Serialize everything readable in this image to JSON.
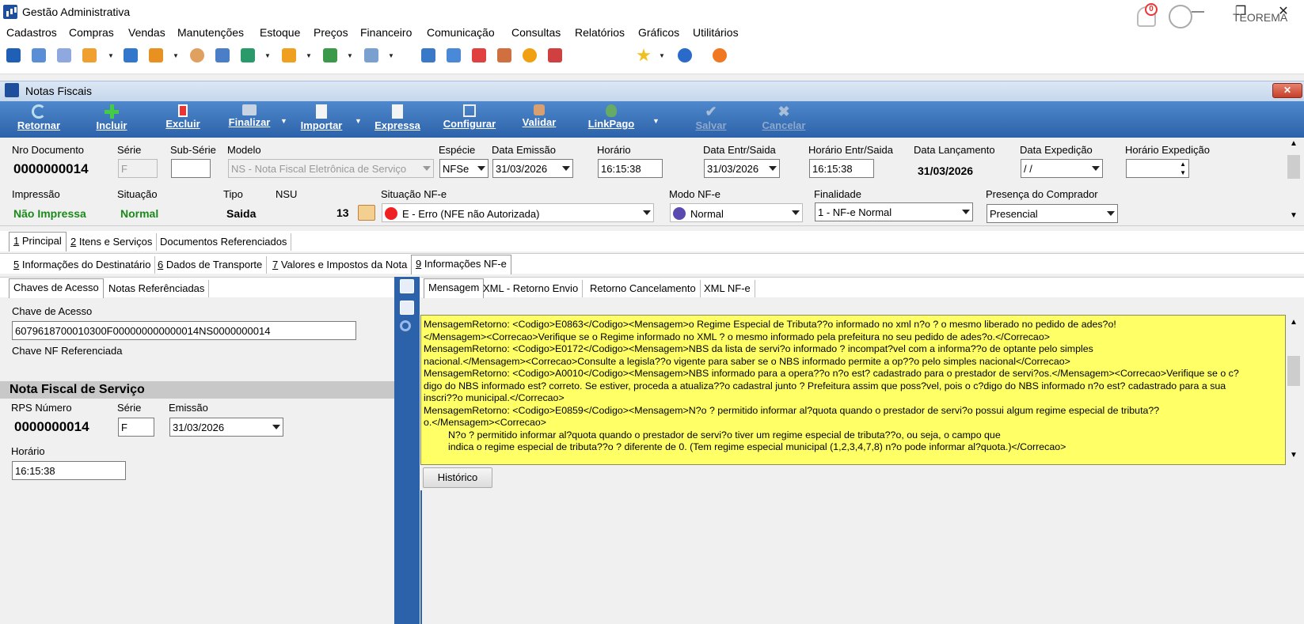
{
  "app": {
    "title": "Gestão Administrativa",
    "company": "TEOREMA",
    "notifications": "0"
  },
  "window_controls": {
    "minimize": "—",
    "restore": "❐",
    "close": "✕"
  },
  "menu": [
    "Cadastros",
    "Compras",
    "Vendas",
    "Manutenções",
    "Estoque",
    "Preços",
    "Financeiro",
    "Comunicação",
    "Consultas",
    "Relatórios",
    "Gráficos",
    "Utilitários"
  ],
  "window": {
    "title": "Notas Fiscais",
    "close": "✕"
  },
  "actions": {
    "retornar": "Retornar",
    "incluir": "Incluir",
    "excluir": "Excluir",
    "finalizar": "Finalizar",
    "importar": "Importar",
    "expressa": "Expressa",
    "configurar": "Configurar",
    "validar": "Validar",
    "linkpago": "LinkPago",
    "salvar": "Salvar",
    "cancelar": "Cancelar"
  },
  "form": {
    "nro_documento": {
      "label": "Nro Documento",
      "value": "0000000014"
    },
    "serie": {
      "label": "Série",
      "value": "F"
    },
    "sub_serie": {
      "label": "Sub-Série",
      "value": ""
    },
    "modelo": {
      "label": "Modelo",
      "value": "NS - Nota Fiscal Eletrônica de Serviço"
    },
    "especie": {
      "label": "Espécie",
      "value": "NFSe"
    },
    "data_emissao": {
      "label": "Data Emissão",
      "value": "31/03/2026"
    },
    "horario": {
      "label": "Horário",
      "value": "16:15:38"
    },
    "data_entr_saida": {
      "label": "Data Entr/Saida",
      "value": "31/03/2026"
    },
    "horario_entr_saida": {
      "label": "Horário Entr/Saida",
      "value": "16:15:38"
    },
    "data_lancamento": {
      "label": "Data Lançamento",
      "value": "31/03/2026"
    },
    "data_expedicao": {
      "label": "Data Expedição",
      "value": " / /"
    },
    "horario_expedicao": {
      "label": "Horário Expedição",
      "value": ""
    },
    "impressao": {
      "label": "Impressão",
      "value": "Não Impressa"
    },
    "situacao": {
      "label": "Situação",
      "value": "Normal"
    },
    "tipo": {
      "label": "Tipo",
      "value": "Saida"
    },
    "nsu": {
      "label": "NSU",
      "value": "13"
    },
    "situacao_nfe": {
      "label": "Situação NF-e",
      "value": "E - Erro (NFE não Autorizada)"
    },
    "modo_nfe": {
      "label": "Modo NF-e",
      "value": "Normal"
    },
    "finalidade": {
      "label": "Finalidade",
      "value": "1 - NF-e Normal"
    },
    "presenca": {
      "label": "Presença do Comprador",
      "value": "Presencial"
    }
  },
  "tabs_main": [
    {
      "key": "1",
      "label": " Principal"
    },
    {
      "key": "2",
      "label": " Itens e Serviços"
    },
    {
      "key": "",
      "label": "Documentos Referenciados"
    }
  ],
  "tabs_sub": [
    {
      "key": "5",
      "label": " Informações do Destinatário"
    },
    {
      "key": "6",
      "label": " Dados de Transporte"
    },
    {
      "key": "7",
      "label": " Valores e Impostos da Nota"
    },
    {
      "key": "9",
      "label": " Informações NF-e"
    }
  ],
  "tabs_left": [
    "Chaves de Acesso",
    "Notas Referênciadas"
  ],
  "tabs_right": [
    "Mensagem",
    "XML - Retorno Envio",
    "Retorno Cancelamento",
    "XML NF-e"
  ],
  "left": {
    "chave_acesso_label": "Chave de Acesso",
    "chave_acesso_value": "6079618700010300F000000000000014NS0000000014",
    "chave_nf_ref_label": "Chave NF Referenciada",
    "section_title": "Nota Fiscal de Serviço",
    "rps_label": "RPS Número",
    "rps_value": "0000000014",
    "serie_label": "Série",
    "serie_value": "F",
    "emissao_label": "Emissão",
    "emissao_value": "31/03/2026",
    "horario_label": "Horário",
    "horario_value": "16:15:38"
  },
  "message_lines": [
    "MensagemRetorno: <Codigo>E0863</Codigo><Mensagem>o Regime Especial de Tributa??o informado no xml n?o ? o mesmo liberado no pedido de ades?o!",
    "</Mensagem><Correcao>Verifique se o Regime informado no XML ? o mesmo informado pela prefeitura no seu pedido de ades?o.</Correcao>",
    "MensagemRetorno: <Codigo>E0172</Codigo><Mensagem>NBS da lista de servi?o informado ? incompat?vel com a informa??o de optante pelo simples",
    "nacional.</Mensagem><Correcao>Consulte a legisla??o vigente para saber se o NBS informado permite a op??o pelo simples nacional</Correcao>",
    "MensagemRetorno: <Codigo>A0010</Codigo><Mensagem>NBS informado para a opera??o n?o est? cadastrado para o prestador de servi?os.</Mensagem><Correcao>Verifique se o c?",
    "digo do NBS informado est? correto. Se estiver, proceda a atualiza??o cadastral junto ? Prefeitura assim que poss?vel, pois o c?digo do NBS informado n?o est? cadastrado para a sua",
    "inscri??o municipal.</Correcao>",
    "MensagemRetorno: <Codigo>E0859</Codigo><Mensagem>N?o ? permitido informar al?quota quando o prestador de servi?o possui algum regime especial de tributa??",
    "o.</Mensagem><Correcao>",
    "         N?o ? permitido informar al?quota quando o prestador de servi?o tiver um regime especial de tributa??o, ou seja, o campo que",
    "         indica o regime especial de tributa??o ? diferente de 0. (Tem regime especial municipal (1,2,3,4,7,8) n?o pode informar al?quota.)</Correcao>"
  ],
  "historico_button": "Histórico"
}
